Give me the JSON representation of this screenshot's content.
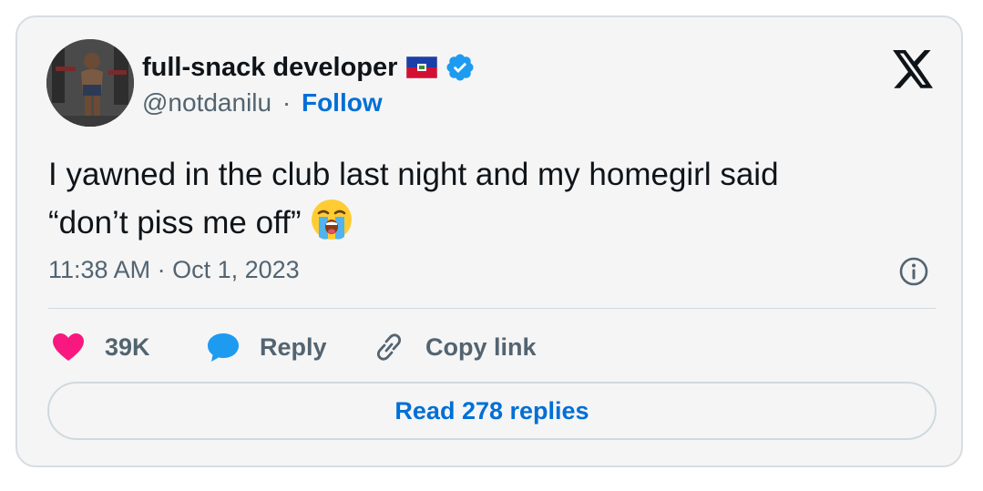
{
  "author": {
    "display_name": "full-snack developer",
    "handle": "@notdanilu",
    "separator": "·",
    "follow_label": "Follow",
    "flag_icon": "haiti-flag-icon",
    "verified_icon": "verified-badge-icon"
  },
  "tweet": {
    "line1": "I yawned in the club last night and my homegirl said",
    "line2": "“don’t piss me off”",
    "emoji": "loudly-crying-face-emoji"
  },
  "timestamp": "11:38 AM · Oct 1, 2023",
  "actions": {
    "like_count": "39K",
    "reply_label": "Reply",
    "copy_label": "Copy link"
  },
  "read_replies_label": "Read 278 replies",
  "colors": {
    "link_blue": "#006fd6",
    "like_pink": "#f91880",
    "reply_blue": "#1d9bf0",
    "muted": "#536471",
    "card_bg": "#f5f5f5"
  }
}
